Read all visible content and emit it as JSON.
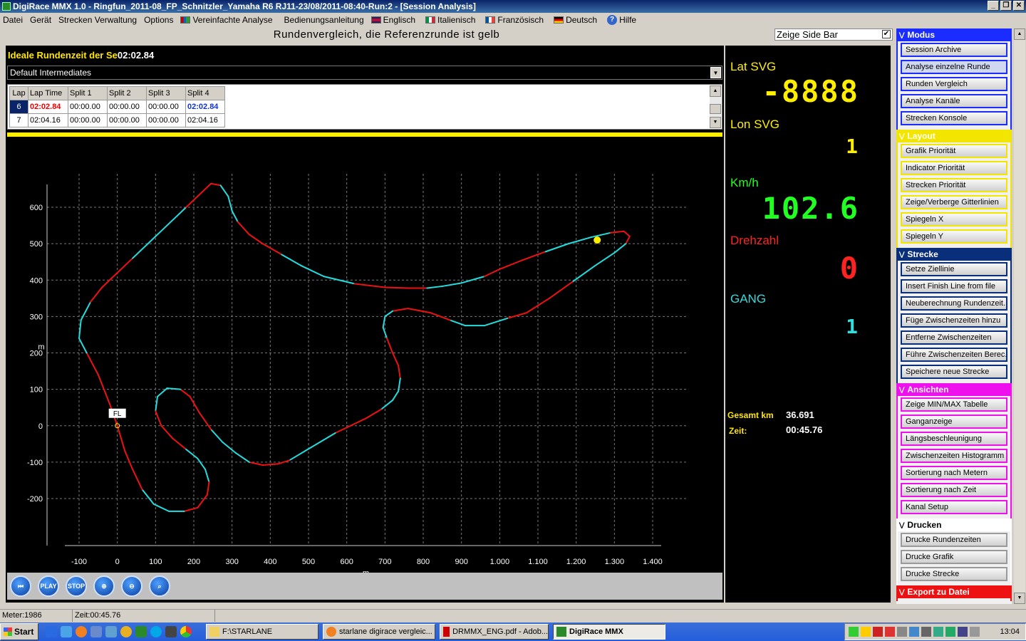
{
  "window": {
    "title": "DigiRace MMX 1.0 -  Ringfun_2011-08_FP_Schnitzler_Yamaha R6 RJ11-23/08/2011-08:40-Run:2 - [Session Analysis]"
  },
  "menu": [
    {
      "label": "Datei",
      "icon": null
    },
    {
      "label": "Gerät",
      "icon": null
    },
    {
      "label": "Strecken Verwaltung",
      "icon": null
    },
    {
      "label": "Options",
      "icon": null
    },
    {
      "label": "Vereinfachte Analyse",
      "icon": "chart-icon"
    },
    {
      "label": "Bedienungsanleitung",
      "icon": null
    },
    {
      "label": "Englisch",
      "icon": "flag-uk-icon"
    },
    {
      "label": "Italienisch",
      "icon": "flag-it-icon"
    },
    {
      "label": "Französisch",
      "icon": "flag-fr-icon"
    },
    {
      "label": "Deutsch",
      "icon": "flag-de-icon"
    },
    {
      "label": "Hilfe",
      "icon": "help-icon"
    }
  ],
  "header": {
    "title": "Rundenvergleich, die Referenzrunde ist gelb",
    "sidebar_toggle": "Zeige Side Bar",
    "sidebar_checked": true
  },
  "ideal": {
    "label": "Ideale Rundenzeit der Se",
    "value": "02:02.84"
  },
  "intermediates": {
    "selected": "Default Intermediates"
  },
  "laps": {
    "columns": [
      "Lap",
      "Lap Time",
      "Split 1",
      "Split 2",
      "Split 3",
      "Split 4"
    ],
    "rows": [
      {
        "cells": [
          "6",
          "02:02.84",
          "00:00.00",
          "00:00.00",
          "00:00.00",
          "02:02.84"
        ],
        "highlight": true
      },
      {
        "cells": [
          "7",
          "02:04.16",
          "00:00.00",
          "00:00.00",
          "00:00.00",
          "02:04.16"
        ],
        "highlight": false
      }
    ]
  },
  "chart_data": {
    "type": "line",
    "xlabel": "m",
    "ylabel": "m",
    "xlim": [
      -100,
      1400
    ],
    "ylim": [
      -200,
      600
    ],
    "x_ticks": [
      "-100",
      "0",
      "100",
      "200",
      "300",
      "400",
      "500",
      "600",
      "700",
      "800",
      "900",
      "1.000",
      "1.100",
      "1.200",
      "1.300",
      "1.400"
    ],
    "y_ticks": [
      "600",
      "500",
      "400",
      "300",
      "200",
      "100",
      "0",
      "-100",
      "-200"
    ],
    "grid": true,
    "start_marker": "FL",
    "current_position": [
      1255,
      510
    ],
    "track": [
      [
        0,
        0
      ],
      [
        -20,
        60
      ],
      [
        -50,
        140
      ],
      [
        -80,
        200
      ],
      [
        -100,
        240
      ],
      [
        -95,
        290
      ],
      [
        -70,
        340
      ],
      [
        -40,
        380
      ],
      [
        0,
        420
      ],
      [
        40,
        460
      ],
      [
        80,
        500
      ],
      [
        130,
        550
      ],
      [
        180,
        600
      ],
      [
        220,
        640
      ],
      [
        245,
        665
      ],
      [
        270,
        660
      ],
      [
        290,
        630
      ],
      [
        300,
        590
      ],
      [
        315,
        560
      ],
      [
        345,
        525
      ],
      [
        380,
        500
      ],
      [
        430,
        470
      ],
      [
        480,
        440
      ],
      [
        540,
        410
      ],
      [
        620,
        390
      ],
      [
        700,
        380
      ],
      [
        760,
        378
      ],
      [
        810,
        378
      ],
      [
        850,
        383
      ],
      [
        900,
        392
      ],
      [
        960,
        410
      ],
      [
        1000,
        430
      ],
      [
        1060,
        455
      ],
      [
        1120,
        478
      ],
      [
        1180,
        500
      ],
      [
        1240,
        518
      ],
      [
        1290,
        530
      ],
      [
        1325,
        534
      ],
      [
        1340,
        520
      ],
      [
        1330,
        500
      ],
      [
        1300,
        475
      ],
      [
        1250,
        440
      ],
      [
        1190,
        395
      ],
      [
        1130,
        350
      ],
      [
        1070,
        310
      ],
      [
        1020,
        295
      ],
      [
        960,
        275
      ],
      [
        910,
        275
      ],
      [
        870,
        290
      ],
      [
        820,
        310
      ],
      [
        760,
        322
      ],
      [
        720,
        315
      ],
      [
        700,
        300
      ],
      [
        695,
        270
      ],
      [
        705,
        240
      ],
      [
        720,
        200
      ],
      [
        735,
        165
      ],
      [
        740,
        130
      ],
      [
        735,
        95
      ],
      [
        720,
        70
      ],
      [
        690,
        45
      ],
      [
        650,
        20
      ],
      [
        610,
        0
      ],
      [
        570,
        -20
      ],
      [
        530,
        -45
      ],
      [
        490,
        -70
      ],
      [
        450,
        -95
      ],
      [
        420,
        -105
      ],
      [
        380,
        -108
      ],
      [
        345,
        -100
      ],
      [
        310,
        -75
      ],
      [
        275,
        -45
      ],
      [
        245,
        -10
      ],
      [
        215,
        35
      ],
      [
        190,
        80
      ],
      [
        165,
        100
      ],
      [
        130,
        103
      ],
      [
        105,
        80
      ],
      [
        100,
        40
      ],
      [
        115,
        0
      ],
      [
        145,
        -35
      ],
      [
        180,
        -65
      ],
      [
        210,
        -90
      ],
      [
        230,
        -120
      ],
      [
        240,
        -155
      ],
      [
        235,
        -190
      ],
      [
        210,
        -225
      ],
      [
        175,
        -235
      ],
      [
        135,
        -235
      ],
      [
        95,
        -215
      ],
      [
        65,
        -175
      ],
      [
        40,
        -120
      ],
      [
        20,
        -70
      ],
      [
        0,
        0
      ]
    ]
  },
  "gauges": [
    {
      "label": "Lat SVG",
      "value": "-8888",
      "color": "#ffee00"
    },
    {
      "label": "Lon SVG",
      "value": "1",
      "color": "#ffee00"
    },
    {
      "label": "Km/h",
      "value": "102.6",
      "color": "#22ff22"
    },
    {
      "label": "Drehzahl",
      "value": "0",
      "color": "#ff2222"
    },
    {
      "label": "GANG",
      "value": "1",
      "color": "#33dddd"
    }
  ],
  "totals": {
    "km_label": "Gesamt km",
    "km_value": "36.691",
    "time_label": "Zeit:",
    "time_value": "00:45.76"
  },
  "playback": [
    {
      "label": "",
      "icon": "rewind-icon"
    },
    {
      "label": "PLAY",
      "icon": null
    },
    {
      "label": "STOP",
      "icon": null
    },
    {
      "label": "",
      "icon": "zoom-in-icon"
    },
    {
      "label": "",
      "icon": "zoom-out-icon"
    },
    {
      "label": "",
      "icon": "zoom-fit-icon"
    }
  ],
  "sidebar": [
    {
      "title": "Modus",
      "color": "#1a2cff",
      "items": [
        "Session Archive",
        "Analyse einzelne Runde",
        "Runden Vergleich",
        "Analyse Kanäle",
        "Strecken Konsole"
      ],
      "active": 1
    },
    {
      "title": "Layout",
      "color": "#f2e600",
      "items": [
        "Grafik Priorität",
        "Indicator Priorität",
        "Strecken Priorität",
        "Zeige/Verberge Gitterlinien",
        "Spiegeln X",
        "Spiegeln Y"
      ],
      "active": -1
    },
    {
      "title": "Strecke",
      "color": "#0a2f7a",
      "items": [
        "Setze Ziellinie",
        "Insert Finish Line from file",
        "Neuberechnung Rundenzeit...",
        "Füge Zwischenzeiten hinzu",
        "Entferne Zwischenzeiten",
        "Führe Zwischenzeiten Berec...",
        "Speichere neue Strecke"
      ],
      "active": -1
    },
    {
      "title": "Ansichten",
      "color": "#ee11ee",
      "items": [
        "Zeige MIN/MAX Tabelle",
        "Ganganzeige",
        "Längsbeschleunigung",
        "Zwischenzeiten Histogramm",
        "Sortierung nach Metern",
        "Sortierung nach Zeit",
        "Kanal Setup"
      ],
      "active": -1
    },
    {
      "title": "Drucken",
      "color": "#ffffff",
      "items": [
        "Drucke Rundenzeiten",
        "Drucke Grafik",
        "Drucke Strecke"
      ],
      "active": -1
    },
    {
      "title": "Export zu Datei",
      "color": "#ee1111",
      "items": [],
      "active": -1
    }
  ],
  "status": {
    "meter": "Meter:1986",
    "zeit": "Zeit:00:45.76"
  },
  "taskbar": {
    "start": "Start",
    "tasks": [
      {
        "label": "F:\\STARLANE",
        "icon": "folder-icon"
      },
      {
        "label": "starlane digirace vergleic...",
        "icon": "firefox-icon"
      },
      {
        "label": "DRMMX_ENG.pdf - Adob...",
        "icon": "pdf-icon"
      },
      {
        "label": "DigiRace MMX",
        "icon": "app-icon",
        "active": true
      }
    ],
    "clock": "13:04"
  }
}
